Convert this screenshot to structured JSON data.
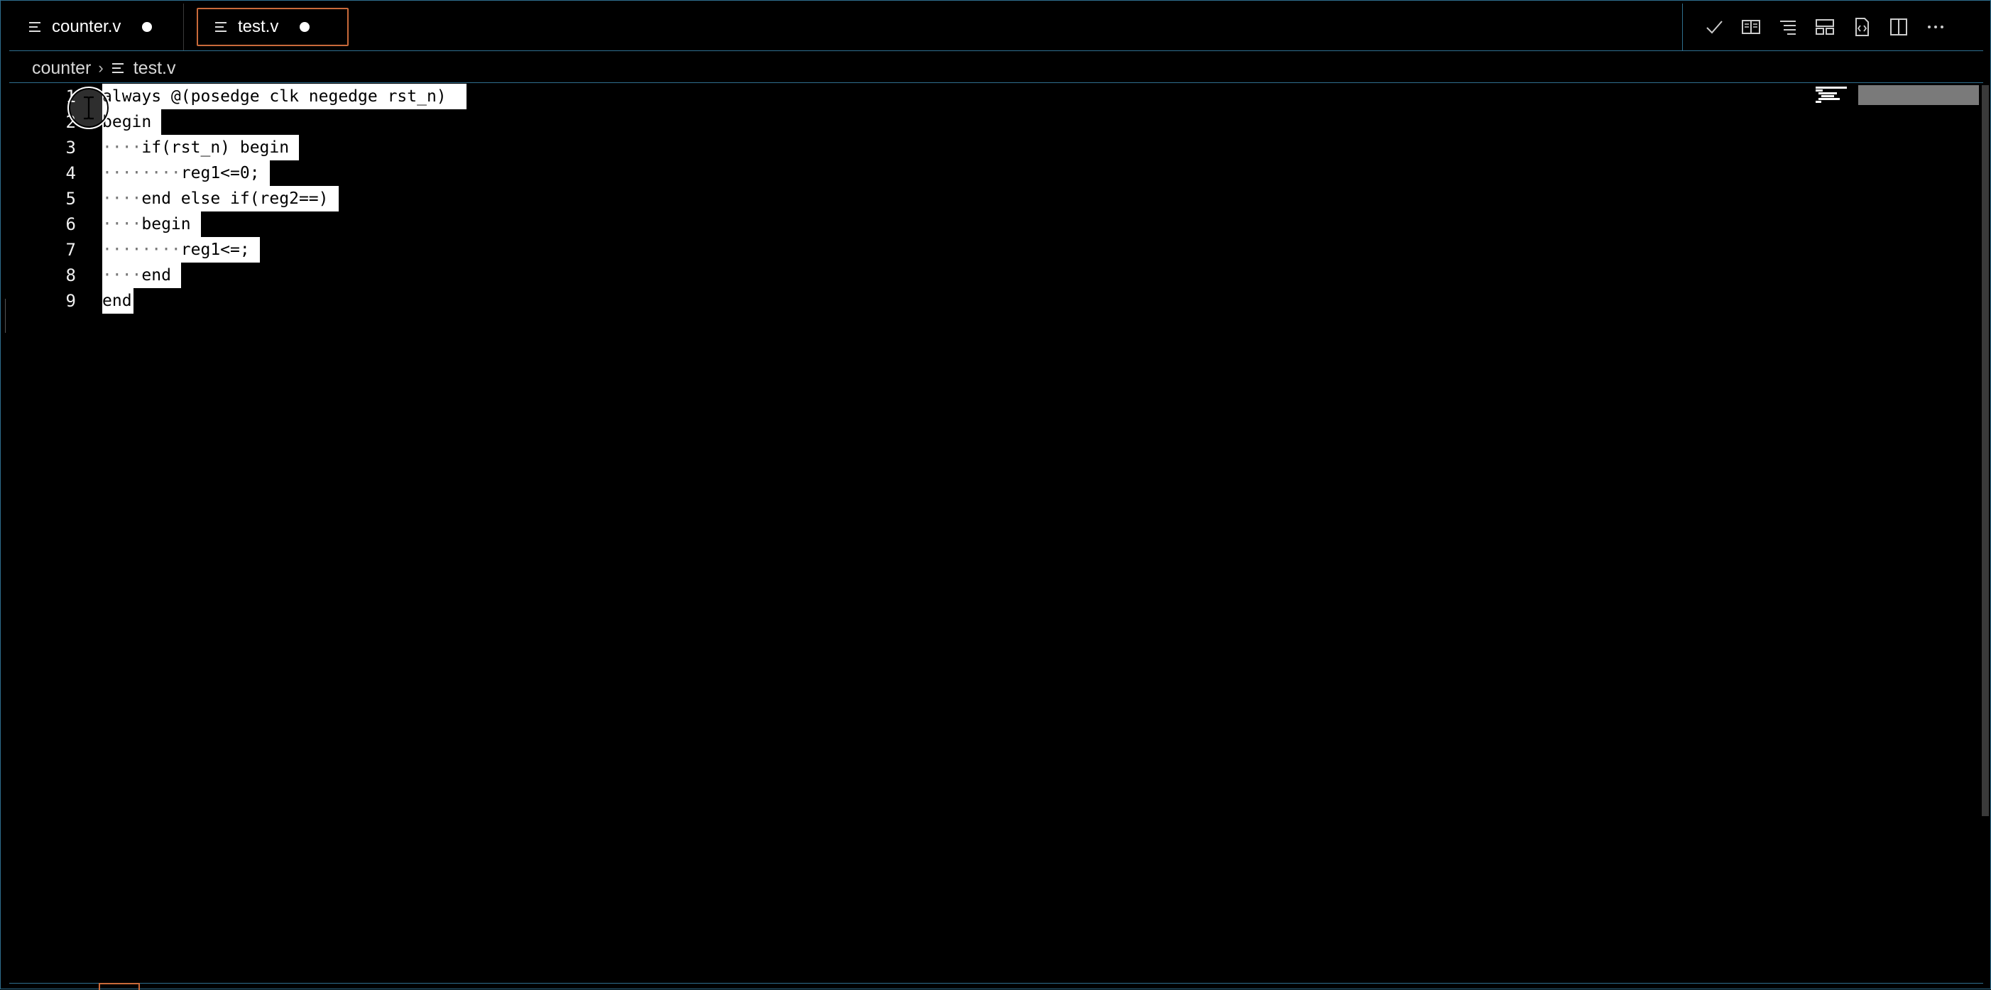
{
  "tabs": [
    {
      "label": "counter.v",
      "dirty": true,
      "active": false
    },
    {
      "label": "test.v",
      "dirty": true,
      "active": true
    }
  ],
  "breadcrumb": {
    "folder": "counter",
    "separator": "›",
    "file": "test.v"
  },
  "editor_actions": [
    {
      "name": "check-icon"
    },
    {
      "name": "open-preview-icon"
    },
    {
      "name": "outline-icon"
    },
    {
      "name": "layout-icon"
    },
    {
      "name": "code-view-icon"
    },
    {
      "name": "split-editor-icon"
    },
    {
      "name": "more-actions-icon"
    }
  ],
  "code": {
    "lines": [
      {
        "number": "1",
        "indent": "",
        "text": "always @(posedge clk negedge rst_n) "
      },
      {
        "number": "2",
        "indent": "",
        "text": "begin"
      },
      {
        "number": "3",
        "indent": "····",
        "text": "if(rst_n) begin"
      },
      {
        "number": "4",
        "indent": "········",
        "text": "reg1<=0;"
      },
      {
        "number": "5",
        "indent": "····",
        "text": "end else if(reg2==)"
      },
      {
        "number": "6",
        "indent": "····",
        "text": "begin"
      },
      {
        "number": "7",
        "indent": "········",
        "text": "reg1<=;"
      },
      {
        "number": "8",
        "indent": "····",
        "text": "end"
      },
      {
        "number": "9",
        "indent": "",
        "text": "end"
      }
    ]
  },
  "colors": {
    "background": "#000000",
    "border": "#2f6f8f",
    "active_tab_border": "#c96a3a",
    "selection": "#ffffff"
  }
}
